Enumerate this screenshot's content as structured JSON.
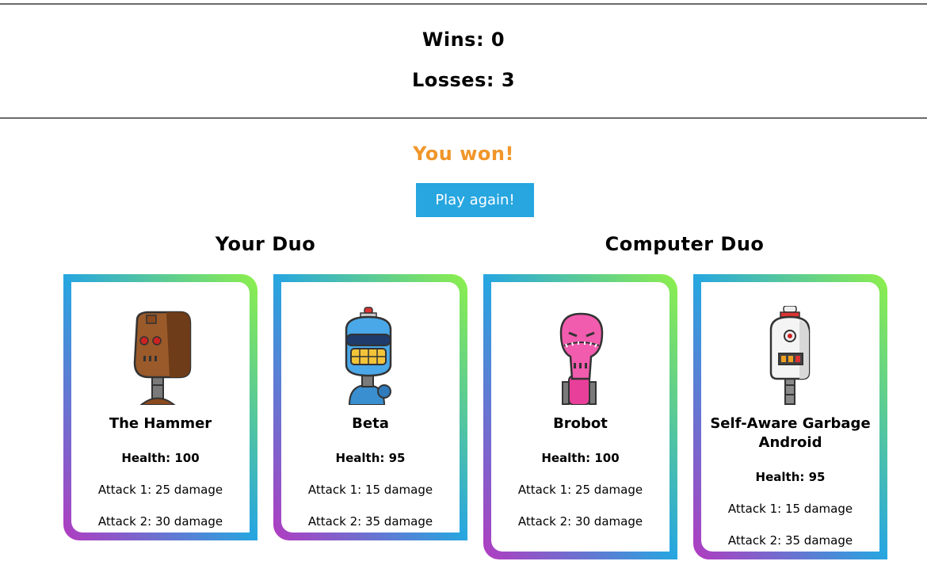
{
  "scoreboard": {
    "wins": "Wins: 0",
    "losses": "Losses: 3"
  },
  "result": {
    "message": "You won!",
    "color": "#f0962a"
  },
  "play_again": {
    "label": "Play again!",
    "color": "#27a6e0"
  },
  "your_duo": {
    "title": "Your Duo",
    "robots": [
      {
        "name": "The Hammer",
        "health": "Health: 100",
        "attack1": "Attack 1: 25 damage",
        "attack2": "Attack 2: 30 damage",
        "icon": "brown-robot-icon"
      },
      {
        "name": "Beta",
        "health": "Health: 95",
        "attack1": "Attack 1: 15 damage",
        "attack2": "Attack 2: 35 damage",
        "icon": "blue-robot-icon"
      }
    ]
  },
  "computer_duo": {
    "title": "Computer Duo",
    "robots": [
      {
        "name": "Brobot",
        "health": "Health: 100",
        "attack1": "Attack 1: 25 damage",
        "attack2": "Attack 2: 30 damage",
        "icon": "pink-robot-icon"
      },
      {
        "name": "Self-Aware Garbage Android",
        "health": "Health: 95",
        "attack1": "Attack 1: 15 damage",
        "attack2": "Attack 2: 35 damage",
        "icon": "white-robot-icon"
      }
    ]
  },
  "colors": {
    "card_gradient": [
      "#b23bc0",
      "#27a6e0",
      "#8ef04a"
    ]
  }
}
